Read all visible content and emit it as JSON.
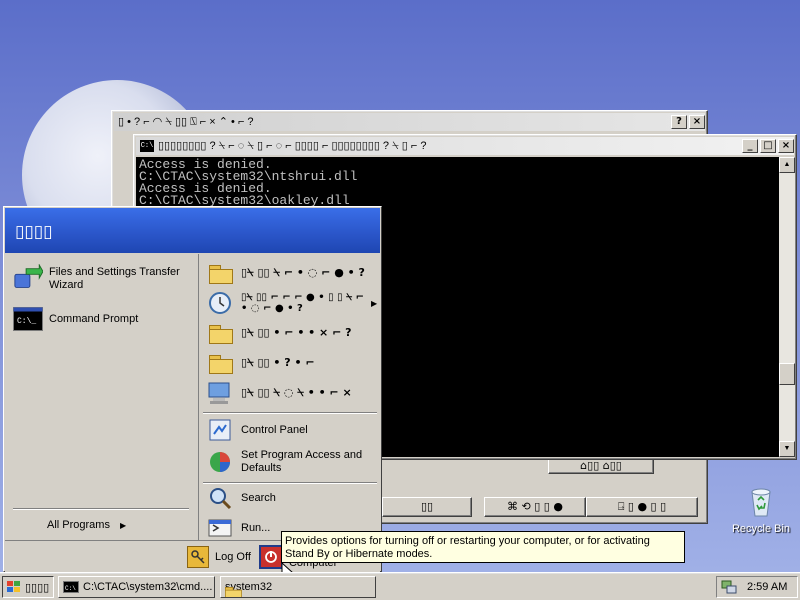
{
  "desktop": {
    "recycle_bin_label": "Recycle Bin",
    "colors": {
      "background_top": "#5b6ec9",
      "background_bottom": "#a3b3e8"
    }
  },
  "back_window": {
    "title": "▯ • ? ⌐ ◠ ⍀ ▯▯ ⍂ ⌐ × ⌃ • ⌐ ?",
    "controls": [
      "?",
      "×"
    ],
    "bottom_buttons": [
      "⌂▯▯ ⌂▯▯",
      "▯▯",
      "▯▯▯▯",
      "⌘ ⟲ ▯ ▯ ●",
      "⍈ ▯ ● ▯ ▯"
    ]
  },
  "console_window": {
    "icon": "C:\\",
    "title": "▯▯▯▯▯▯▯▯ ? ⍀ ⌐ ◌ ⍀ ▯ ⌐ ◌ ⌐ ▯▯▯▯ ⌐ ▯▯▯▯▯▯▯▯ ? ⍀ ▯ ⌐ ?",
    "controls": [
      "_",
      "□",
      "×"
    ],
    "lines": [
      "Access is denied.",
      "C:\\CTAC\\system32\\ntshrui.dll",
      "Access is denied.",
      "C:\\CTAC\\system32\\oakley.dll"
    ]
  },
  "start_menu": {
    "user_name": "▯▯▯▯",
    "pinned": [
      {
        "label": "Files and Settings Transfer Wizard",
        "icon": "transfer-wizard-icon"
      },
      {
        "label": "Command Prompt",
        "icon": "command-prompt-icon"
      }
    ],
    "all_programs": "All Programs",
    "right_items": [
      {
        "label": "▯⍀ ▯▯ ⍀ ⌐ • ◌ ⌐ ● • ?",
        "icon": "my-documents-icon"
      },
      {
        "label": "▯⍀ ▯▯ ⌐ ⌐ ⌐ ● • ▯ ▯ ⍀ ⌐ • ◌ ⌐ ● • ?",
        "icon": "recent-documents-icon",
        "has_submenu": true
      },
      {
        "label": "▯⍀ ▯▯ • ⌐ • • × ⌐ ?",
        "icon": "my-pictures-icon"
      },
      {
        "label": "▯⍀ ▯▯ • ? • ⌐",
        "icon": "my-music-icon"
      },
      {
        "label": "▯⍀ ▯▯ ⍀ ◌ ⍀ • • ⌐ ×",
        "icon": "my-computer-icon"
      },
      {
        "label": "Control Panel",
        "icon": "control-panel-icon"
      },
      {
        "label": "Set Program Access and Defaults",
        "icon": "program-access-icon"
      },
      {
        "label": "Search",
        "icon": "search-icon"
      },
      {
        "label": "Run...",
        "icon": "run-icon"
      }
    ],
    "log_off": "Log Off",
    "turn_off": "Turn Off Computer"
  },
  "tooltip": {
    "text": "Provides options for turning off or restarting your computer, or for activating Stand By or Hibernate modes."
  },
  "taskbar": {
    "start_label": "▯▯▯▯",
    "tasks": [
      {
        "label": "C:\\CTAC\\system32\\cmd....",
        "icon": "command-prompt-icon"
      },
      {
        "label": "system32",
        "icon": "folder-icon"
      }
    ],
    "clock": "2:59 AM"
  }
}
